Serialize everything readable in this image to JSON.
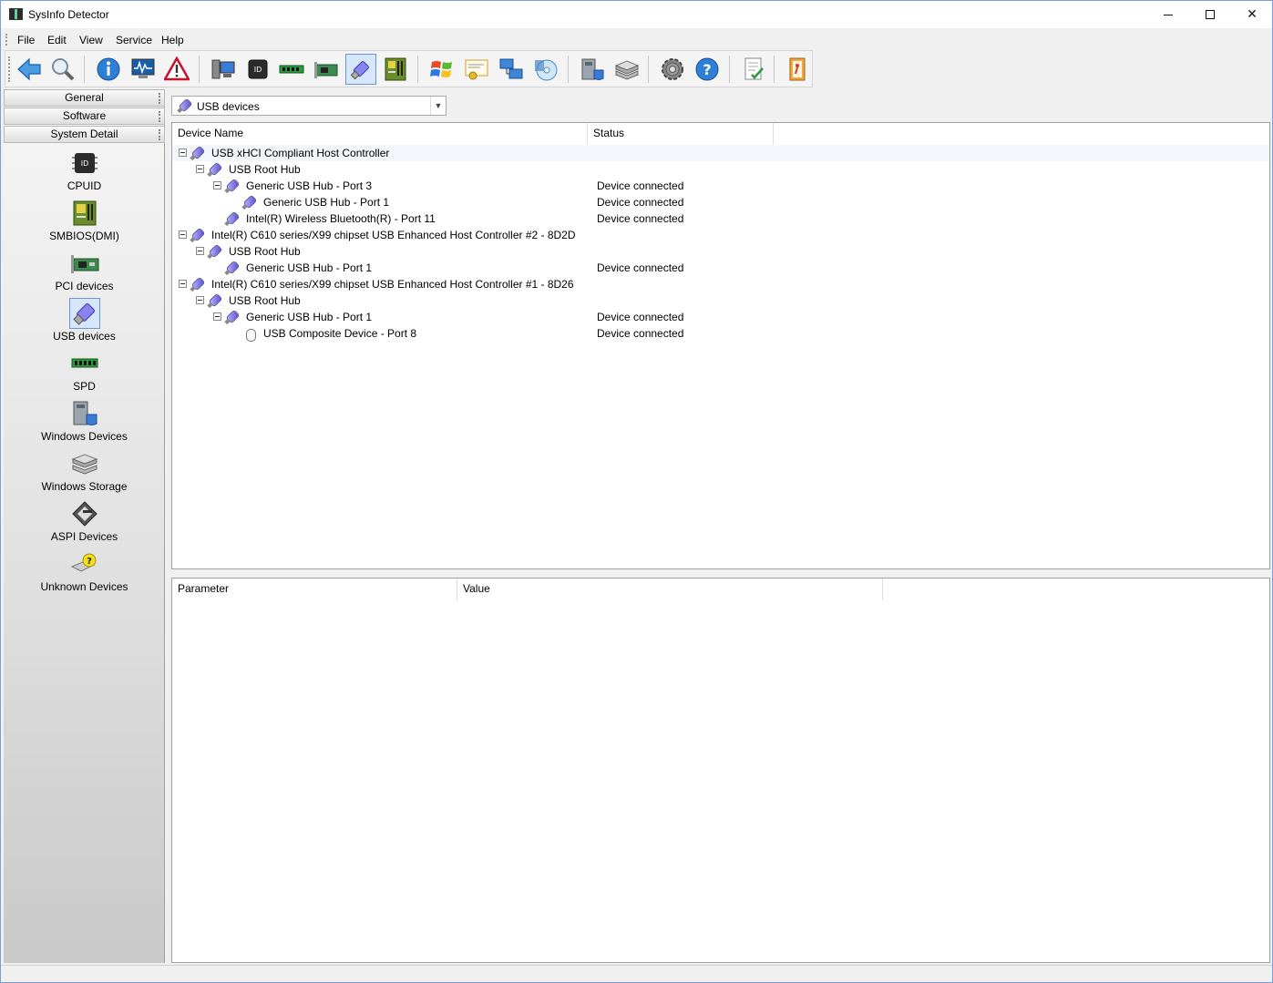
{
  "window": {
    "title": "SysInfo Detector"
  },
  "menu": {
    "items": [
      "File",
      "Edit",
      "View",
      "Service",
      "Help"
    ]
  },
  "toolbar": {
    "buttons": [
      {
        "icon": "back-arrow-icon"
      },
      {
        "icon": "magnifier-icon"
      },
      {
        "icon": "info-icon"
      },
      {
        "icon": "monitor-graph-icon"
      },
      {
        "icon": "warning-icon"
      },
      {
        "icon": "computer-icon"
      },
      {
        "icon": "cpu-id-icon"
      },
      {
        "icon": "memory-module-icon"
      },
      {
        "icon": "pci-card-icon"
      },
      {
        "icon": "usb-icon",
        "active": true
      },
      {
        "icon": "motherboard-icon"
      },
      {
        "icon": "windows-logo-icon"
      },
      {
        "icon": "certificate-icon"
      },
      {
        "icon": "network-icon"
      },
      {
        "icon": "disc-icon"
      },
      {
        "icon": "windows-devices-icon"
      },
      {
        "icon": "storage-icon"
      },
      {
        "icon": "settings-gear-icon"
      },
      {
        "icon": "help-icon"
      },
      {
        "icon": "report-icon"
      },
      {
        "icon": "exit-icon"
      }
    ]
  },
  "sidebar": {
    "sections": [
      {
        "label": "General"
      },
      {
        "label": "Software"
      },
      {
        "label": "System Detail"
      }
    ],
    "items": [
      {
        "label": "CPUID",
        "icon": "cpuid-icon"
      },
      {
        "label": "SMBIOS(DMI)",
        "icon": "smbios-icon"
      },
      {
        "label": "PCI devices",
        "icon": "pci-icon"
      },
      {
        "label": "USB devices",
        "icon": "usb-icon",
        "active": true
      },
      {
        "label": "SPD",
        "icon": "spd-icon"
      },
      {
        "label": "Windows Devices",
        "icon": "windows-devices-icon"
      },
      {
        "label": "Windows Storage",
        "icon": "windows-storage-icon"
      },
      {
        "label": "ASPI Devices",
        "icon": "aspi-icon"
      },
      {
        "label": "Unknown Devices",
        "icon": "unknown-devices-icon"
      }
    ]
  },
  "device_selector": {
    "selected": "USB devices"
  },
  "device_table": {
    "columns": [
      "Device Name",
      "Status"
    ],
    "rows": [
      {
        "name": "USB xHCI Compliant Host Controller",
        "status": "",
        "level": 0,
        "expander": true,
        "icon": "usb"
      },
      {
        "name": "USB Root Hub",
        "status": "",
        "level": 1,
        "expander": true,
        "icon": "usb"
      },
      {
        "name": "Generic USB Hub - Port 3",
        "status": "Device connected",
        "level": 2,
        "expander": true,
        "icon": "usb"
      },
      {
        "name": "Generic USB Hub - Port 1",
        "status": "Device connected",
        "level": 3,
        "expander": false,
        "icon": "usb"
      },
      {
        "name": "Intel(R) Wireless Bluetooth(R) - Port 11",
        "status": "Device connected",
        "level": 2,
        "expander": false,
        "icon": "usb"
      },
      {
        "name": "Intel(R) C610 series/X99 chipset USB Enhanced Host Controller #2 - 8D2D",
        "status": "",
        "level": 0,
        "expander": true,
        "icon": "usb"
      },
      {
        "name": "USB Root Hub",
        "status": "",
        "level": 1,
        "expander": true,
        "icon": "usb"
      },
      {
        "name": "Generic USB Hub - Port 1",
        "status": "Device connected",
        "level": 2,
        "expander": false,
        "icon": "usb"
      },
      {
        "name": "Intel(R) C610 series/X99 chipset USB Enhanced Host Controller #1 - 8D26",
        "status": "",
        "level": 0,
        "expander": true,
        "icon": "usb"
      },
      {
        "name": "USB Root Hub",
        "status": "",
        "level": 1,
        "expander": true,
        "icon": "usb"
      },
      {
        "name": "Generic USB Hub - Port 1",
        "status": "Device connected",
        "level": 2,
        "expander": true,
        "icon": "usb"
      },
      {
        "name": "USB Composite Device - Port 8",
        "status": "Device connected",
        "level": 3,
        "expander": false,
        "icon": "mouse"
      }
    ]
  },
  "param_table": {
    "columns": [
      "Parameter",
      "Value"
    ]
  }
}
